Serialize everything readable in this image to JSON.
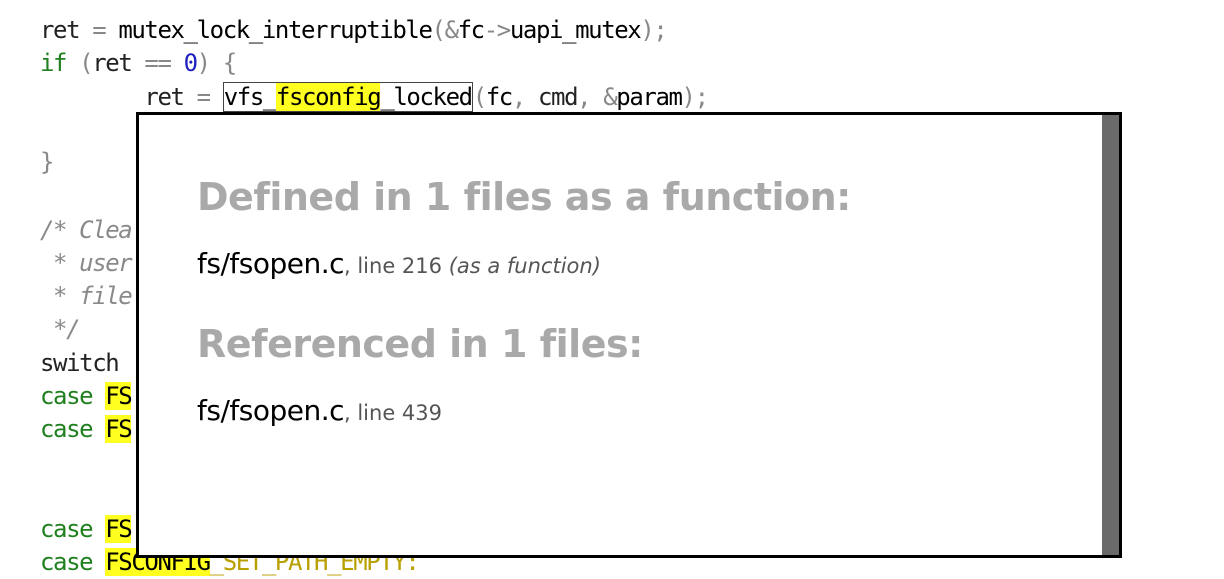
{
  "code": {
    "line1": {
      "ret": "ret",
      "assign": " = ",
      "fn": "mutex_lock_interruptible",
      "open": "(",
      "amp": "&",
      "fc": "fc",
      "arrow": "->",
      "member": "uapi_mutex",
      "close": ");"
    },
    "line2": {
      "kw": "if",
      "open": " (",
      "ret": "ret ",
      "eq": "== ",
      "zero": "0",
      "close": ") {"
    },
    "line3": {
      "indent": "        ",
      "ret": "ret",
      "assign": " = ",
      "fn_pre": "vfs_",
      "fn_hl": "fsconfig",
      "fn_post": "_locked",
      "args_open": "(",
      "fc": "fc",
      "comma1": ", ",
      "cmd": "cmd",
      "comma2": ", ",
      "amp": "&",
      "param": "param",
      "args_close": ");"
    },
    "line5": "}",
    "line7": "/* Clea",
    "line8": " * user",
    "line9": " * file",
    "line10": " */",
    "line11": "switch",
    "line12": {
      "kw": "case ",
      "hl": "FS"
    },
    "line13": {
      "kw": "case ",
      "hl": "FS"
    },
    "line16": {
      "kw": "case ",
      "hl": "FS"
    },
    "line17": {
      "kw": "case ",
      "hl": "FSCONFIG",
      "rest": "_SET_PATH_EMPTY:"
    }
  },
  "popup": {
    "defined_heading": "Defined in 1 files as a function:",
    "defined_results": [
      {
        "file": "fs/fsopen.c",
        "line": ", line 216 ",
        "kind": "(as a function)"
      }
    ],
    "referenced_heading": "Referenced in 1 files:",
    "referenced_results": [
      {
        "file": "fs/fsopen.c",
        "line": ", line 439"
      }
    ]
  }
}
